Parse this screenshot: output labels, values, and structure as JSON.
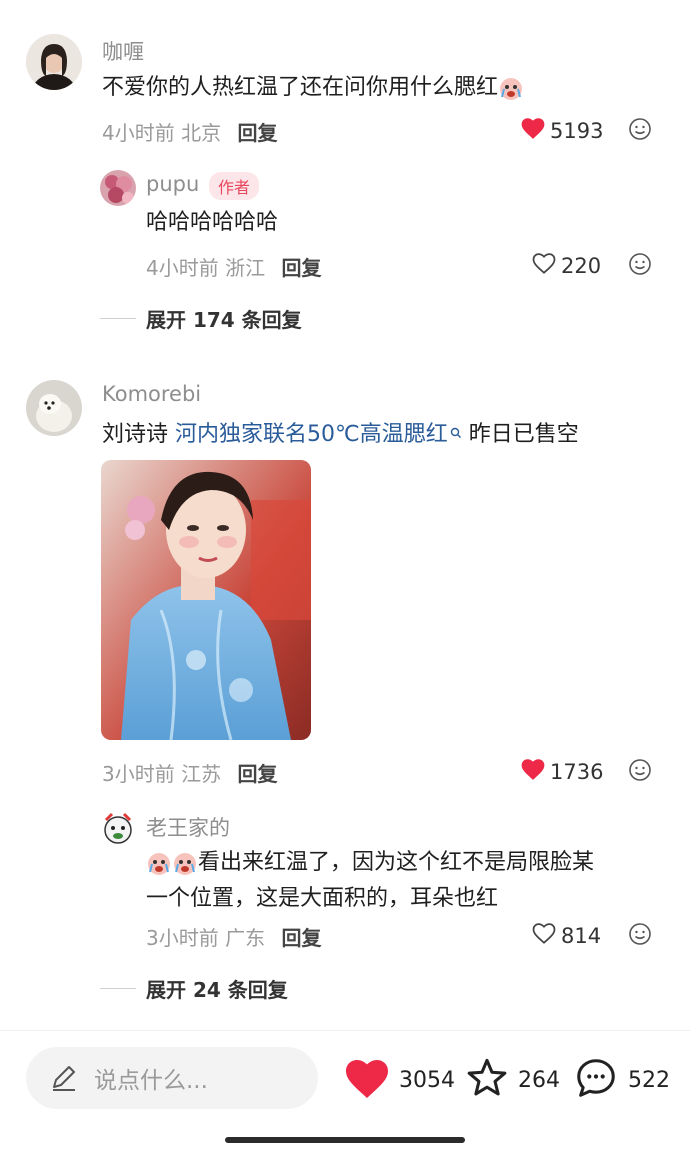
{
  "comments": [
    {
      "user": "咖喱",
      "text": "不爱你的人热红温了还在问你用什么腮红",
      "time": "4小时前",
      "location": "北京",
      "reply_label": "回复",
      "likes": "5193",
      "liked": true,
      "replies": [
        {
          "user": "pupu",
          "badge": "作者",
          "text": "哈哈哈哈哈哈",
          "time": "4小时前",
          "location": "浙江",
          "reply_label": "回复",
          "likes": "220"
        }
      ],
      "expand_label": "展开 174 条回复"
    },
    {
      "user": "Komorebi",
      "text_prefix": "刘诗诗 ",
      "link_text": "河内独家联名50℃高温腮红",
      "text_suffix": " 昨日已售空",
      "time": "3小时前",
      "location": "江苏",
      "reply_label": "回复",
      "likes": "1736",
      "liked": true,
      "replies": [
        {
          "user": "老王家的",
          "text_line1": "看出来红温了，因为这个红不是局限脸某",
          "text_line2": "一个位置，这是大面积的，耳朵也红",
          "time": "3小时前",
          "location": "广东",
          "reply_label": "回复",
          "likes": "814"
        }
      ],
      "expand_label": "展开 24 条回复"
    }
  ],
  "bottom_bar": {
    "input_placeholder": "说点什么...",
    "like_count": "3054",
    "star_count": "264",
    "comment_count": "522"
  },
  "colors": {
    "like_red": "#ee2847",
    "link_blue": "#2a5c9a",
    "author_tag_bg": "#fde6ea"
  }
}
